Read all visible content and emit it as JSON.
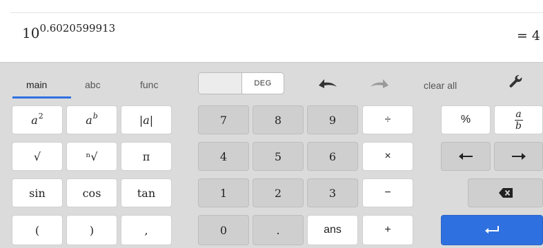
{
  "expression": {
    "base": "10",
    "exponent": "0.6020599913"
  },
  "result": "= 4",
  "tabs": [
    {
      "label": "main",
      "active": true
    },
    {
      "label": "abc",
      "active": false
    },
    {
      "label": "func",
      "active": false
    }
  ],
  "angle_toggle": {
    "label": "DEG"
  },
  "toolbar": {
    "clear_all": "clear all"
  },
  "keys": {
    "a_squared": {
      "base": "a",
      "exp": "2"
    },
    "a_power_b": {
      "base": "a",
      "exp": "b"
    },
    "abs": "|a|",
    "sqrt": "√",
    "nth_root": "ⁿ√",
    "pi": "π",
    "sin": "sin",
    "cos": "cos",
    "tan": "tan",
    "lparen": "(",
    "rparen": ")",
    "comma": ",",
    "n7": "7",
    "n8": "8",
    "n9": "9",
    "n4": "4",
    "n5": "5",
    "n6": "6",
    "n1": "1",
    "n2": "2",
    "n3": "3",
    "n0": "0",
    "dot": ".",
    "ans": "ans",
    "divide": "÷",
    "multiply": "×",
    "minus": "−",
    "plus": "+",
    "percent": "%",
    "fraction": {
      "num": "a",
      "den": "b"
    }
  },
  "colors": {
    "accent": "#2f70e0",
    "dark_key": "#cfcfcf",
    "keypad_bg": "#dbdbdb"
  }
}
